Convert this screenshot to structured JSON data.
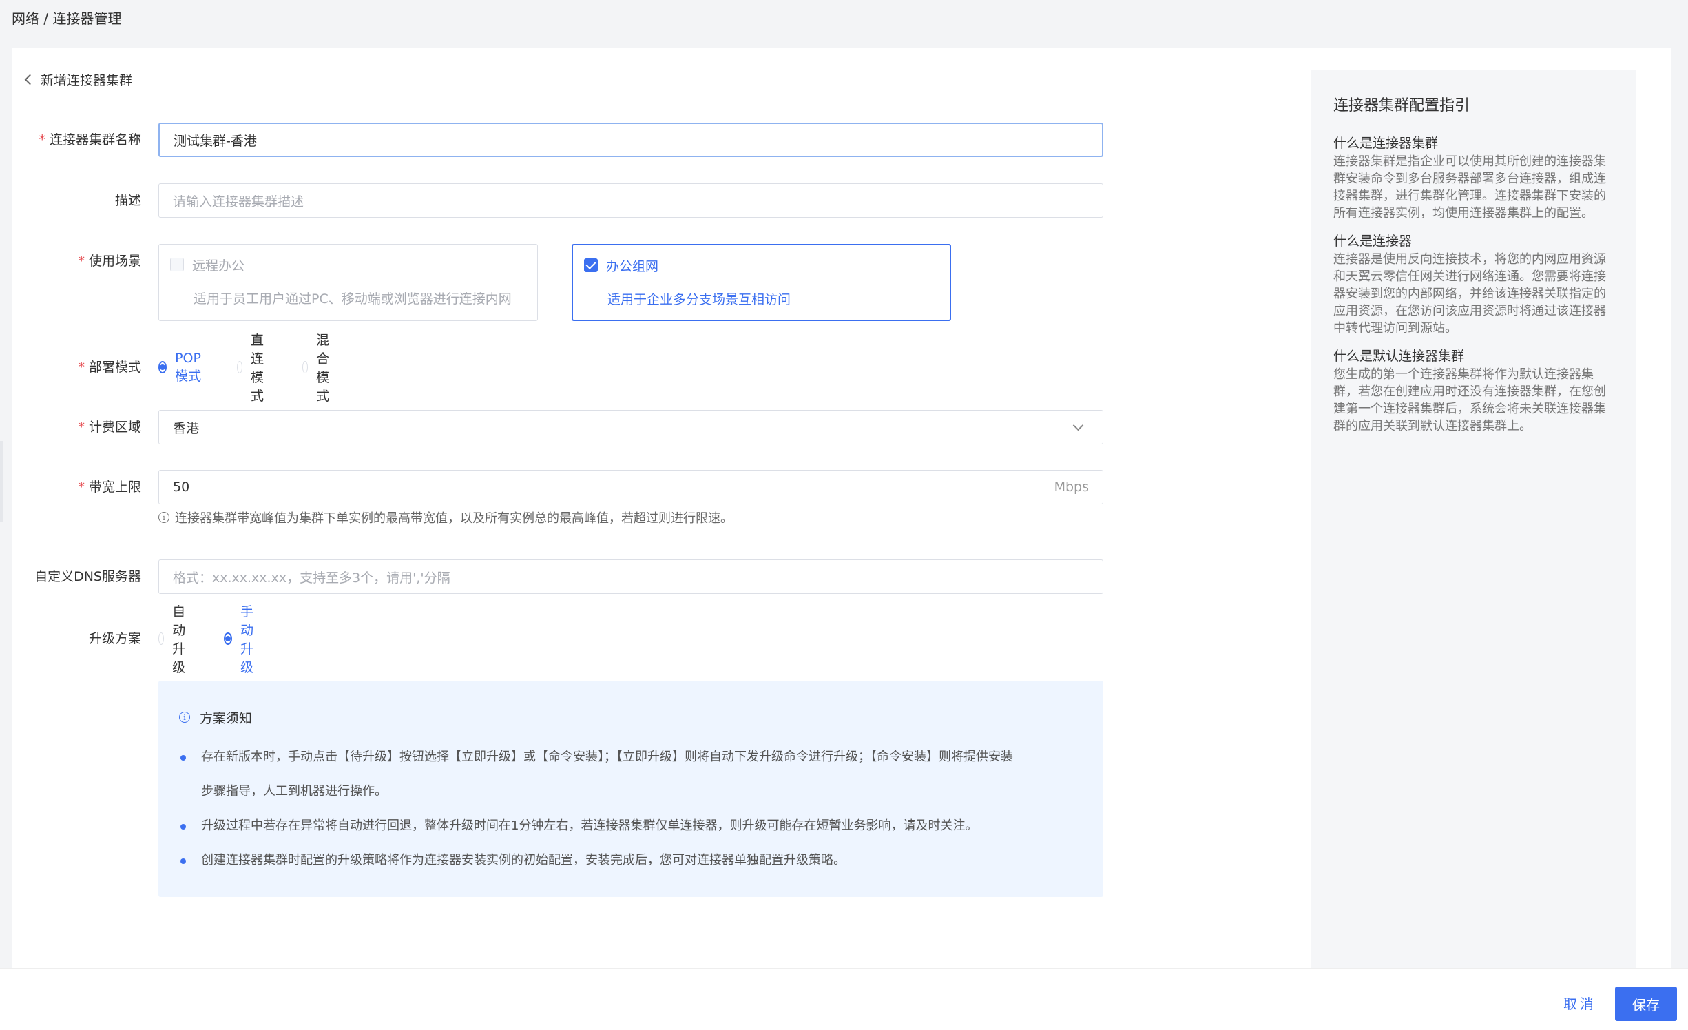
{
  "breadcrumb": "网络 / 连接器管理",
  "page": {
    "back_title": "新增连接器集群"
  },
  "form": {
    "name": {
      "label": "连接器集群名称",
      "value": "测试集群-香港"
    },
    "desc": {
      "label": "描述",
      "placeholder": "请输入连接器集群描述"
    },
    "scene": {
      "label": "使用场景",
      "options": [
        {
          "title": "远程办公",
          "desc": "适用于员工用户通过PC、移动端或浏览器进行连接内网",
          "checked": false
        },
        {
          "title": "办公组网",
          "desc": "适用于企业多分支场景互相访问",
          "checked": true
        }
      ]
    },
    "deploy": {
      "label": "部署模式",
      "options": [
        "POP模式",
        "直连模式",
        "混合模式"
      ],
      "selected": "POP模式"
    },
    "region": {
      "label": "计费区域",
      "value": "香港"
    },
    "bandwidth": {
      "label": "带宽上限",
      "value": "50",
      "unit": "Mbps",
      "hint": "连接器集群带宽峰值为集群下单实例的最高带宽值，以及所有实例总的最高峰值，若超过则进行限速。"
    },
    "dns": {
      "label": "自定义DNS服务器",
      "placeholder": "格式：xx.xx.xx.xx，支持至多3个，请用','分隔"
    },
    "upgrade": {
      "label": "升级方案",
      "options": [
        "自动升级",
        "手动升级"
      ],
      "selected": "手动升级"
    }
  },
  "notice": {
    "title": "方案须知",
    "items": [
      "存在新版本时，手动点击【待升级】按钮选择【立即升级】或【命令安装】；【立即升级】则将自动下发升级命令进行升级；【命令安装】则将提供安装",
      "步骤指导，人工到机器进行操作。",
      "升级过程中若存在异常将自动进行回退，整体升级时间在1分钟左右，若连接器集群仅单连接器，则升级可能存在短暂业务影响，请及时关注。",
      "创建连接器集群时配置的升级策略将作为连接器安装实例的初始配置，安装完成后，您可对连接器单独配置升级策略。"
    ]
  },
  "guide": {
    "title": "连接器集群配置指引",
    "sections": [
      {
        "heading": "什么是连接器集群",
        "text": "连接器集群是指企业可以使用其所创建的连接器集群安装命令到多台服务器部署多台连接器，组成连接器集群，进行集群化管理。连接器集群下安装的所有连接器实例，均使用连接器集群上的配置。"
      },
      {
        "heading": "什么是连接器",
        "text": "连接器是使用反向连接技术，将您的内网应用资源和天翼云零信任网关进行网络连通。您需要将连接器安装到您的内部网络，并给该连接器关联指定的应用资源，在您访问该应用资源时将通过该连接器中转代理访问到源站。"
      },
      {
        "heading": "什么是默认连接器集群",
        "text": "您生成的第一个连接器集群将作为默认连接器集群，若您在创建应用时还没有连接器集群，在您创建第一个连接器集群后，系统会将未关联连接器集群的应用关联到默认连接器集群上。"
      }
    ]
  },
  "footer": {
    "cancel": "取消",
    "save": "保存"
  },
  "required_mark": "*",
  "info_glyph": "i"
}
